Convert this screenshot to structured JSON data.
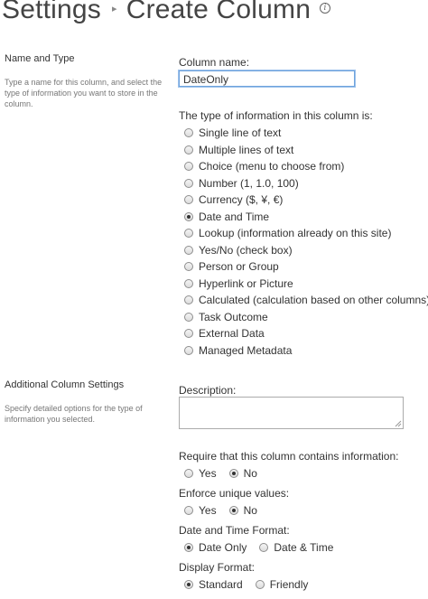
{
  "header": {
    "breadcrumb_root": "Settings",
    "page_title": "Create Column"
  },
  "name_type_section": {
    "heading": "Name and Type",
    "description": "Type a name for this column, and select the type of information you want to store in the column.",
    "column_name_label": "Column name:",
    "column_name_value": "DateOnly",
    "type_label": "The type of information in this column is:",
    "types": [
      {
        "label": "Single line of text",
        "checked": false
      },
      {
        "label": "Multiple lines of text",
        "checked": false
      },
      {
        "label": "Choice (menu to choose from)",
        "checked": false
      },
      {
        "label": "Number (1, 1.0, 100)",
        "checked": false
      },
      {
        "label": "Currency ($, ¥, €)",
        "checked": false
      },
      {
        "label": "Date and Time",
        "checked": true
      },
      {
        "label": "Lookup (information already on this site)",
        "checked": false
      },
      {
        "label": "Yes/No (check box)",
        "checked": false
      },
      {
        "label": "Person or Group",
        "checked": false
      },
      {
        "label": "Hyperlink or Picture",
        "checked": false
      },
      {
        "label": "Calculated (calculation based on other columns)",
        "checked": false
      },
      {
        "label": "Task Outcome",
        "checked": false
      },
      {
        "label": "External Data",
        "checked": false
      },
      {
        "label": "Managed Metadata",
        "checked": false
      }
    ]
  },
  "additional_section": {
    "heading": "Additional Column Settings",
    "description": "Specify detailed options for the type of information you selected.",
    "description_label": "Description:",
    "description_value": "",
    "require_label": "Require that this column contains information:",
    "require_yes": "Yes",
    "require_no": "No",
    "require_selected": "No",
    "unique_label": "Enforce unique values:",
    "unique_yes": "Yes",
    "unique_no": "No",
    "unique_selected": "No",
    "format_label": "Date and Time Format:",
    "format_date_only": "Date Only",
    "format_date_time": "Date & Time",
    "format_selected": "Date Only",
    "display_label": "Display Format:",
    "display_standard": "Standard",
    "display_friendly": "Friendly",
    "display_selected": "Standard"
  },
  "colors": {
    "input_focus_border": "#6fa3dd",
    "text": "#333333",
    "muted_text": "#777777"
  }
}
